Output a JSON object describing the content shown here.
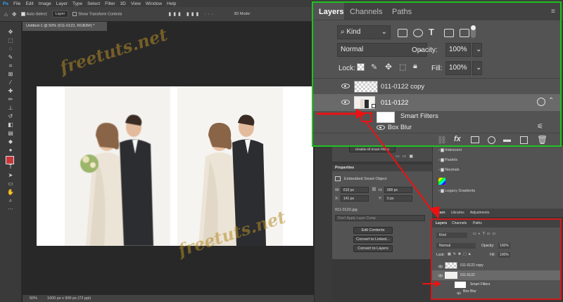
{
  "menu": [
    "File",
    "Edit",
    "Image",
    "Layer",
    "Type",
    "Select",
    "Filter",
    "3D",
    "View",
    "Window",
    "Help"
  ],
  "options": {
    "auto_select": "Auto-Select:",
    "auto_select_target": "Layer",
    "show_transform": "Show Transform Controls",
    "mode_3d": "3D Mode:"
  },
  "document": {
    "tab_title": "Untitled-1 @ 50% (011-0122, RGB/8#) *",
    "zoom": "50%",
    "size_info": "1600 px x 900 px (72 ppi)"
  },
  "properties": {
    "title": "Properties",
    "subtitle": "Embedded Smart Object",
    "w_label": "W:",
    "w_value": "610 px",
    "h_label": "H:",
    "h_value": "900 px",
    "x_label": "X:",
    "x_value": "141 px",
    "y_label": "Y:",
    "y_value": "0 px",
    "filename": "011-0122.jpg",
    "layer_comp": "Don't Apply Layer Comp",
    "buttons": [
      "Edit Contents",
      "Convert to Linked...",
      "Convert to Layers"
    ],
    "disable_filters": "Disable All Smart Filters"
  },
  "swatches": {
    "folders": [
      "Iridescent",
      "Pastels",
      "Neutrals",
      "Legacy Gradients"
    ]
  },
  "lower_tabs": [
    "Learn",
    "Libraries",
    "Adjustments"
  ],
  "layers_zoom": {
    "tabs": [
      "Layers",
      "Channels",
      "Paths"
    ],
    "filter_kind": "Kind",
    "blend_mode": "Normal",
    "opacity_label": "Opacity:",
    "opacity_value": "100%",
    "lock_label": "Lock:",
    "fill_label": "Fill:",
    "fill_value": "100%",
    "layers": [
      {
        "name": "011-0122 copy"
      },
      {
        "name": "011-0122"
      }
    ],
    "smart_filters_label": "Smart Filters",
    "filter_name": "Box Blur"
  },
  "layers_mini": {
    "tabs": [
      "Layers",
      "Channels",
      "Paths"
    ],
    "filter_kind": "Kind",
    "blend_mode": "Normal",
    "opacity_label": "Opacity:",
    "opacity_value": "100%",
    "lock_label": "Lock:",
    "fill_label": "Fill:",
    "fill_value": "100%",
    "layers": [
      {
        "name": "011-0122 copy"
      },
      {
        "name": "011-0122"
      }
    ],
    "smart_filters_label": "Smart Filters",
    "filter_name": "Box Blur"
  },
  "watermark": "freetuts.net",
  "colors": {
    "highlight_green": "#1ec31e",
    "highlight_red": "#d01a1a",
    "panel_bg": "#535353",
    "foreground_color": "#c8363c"
  }
}
